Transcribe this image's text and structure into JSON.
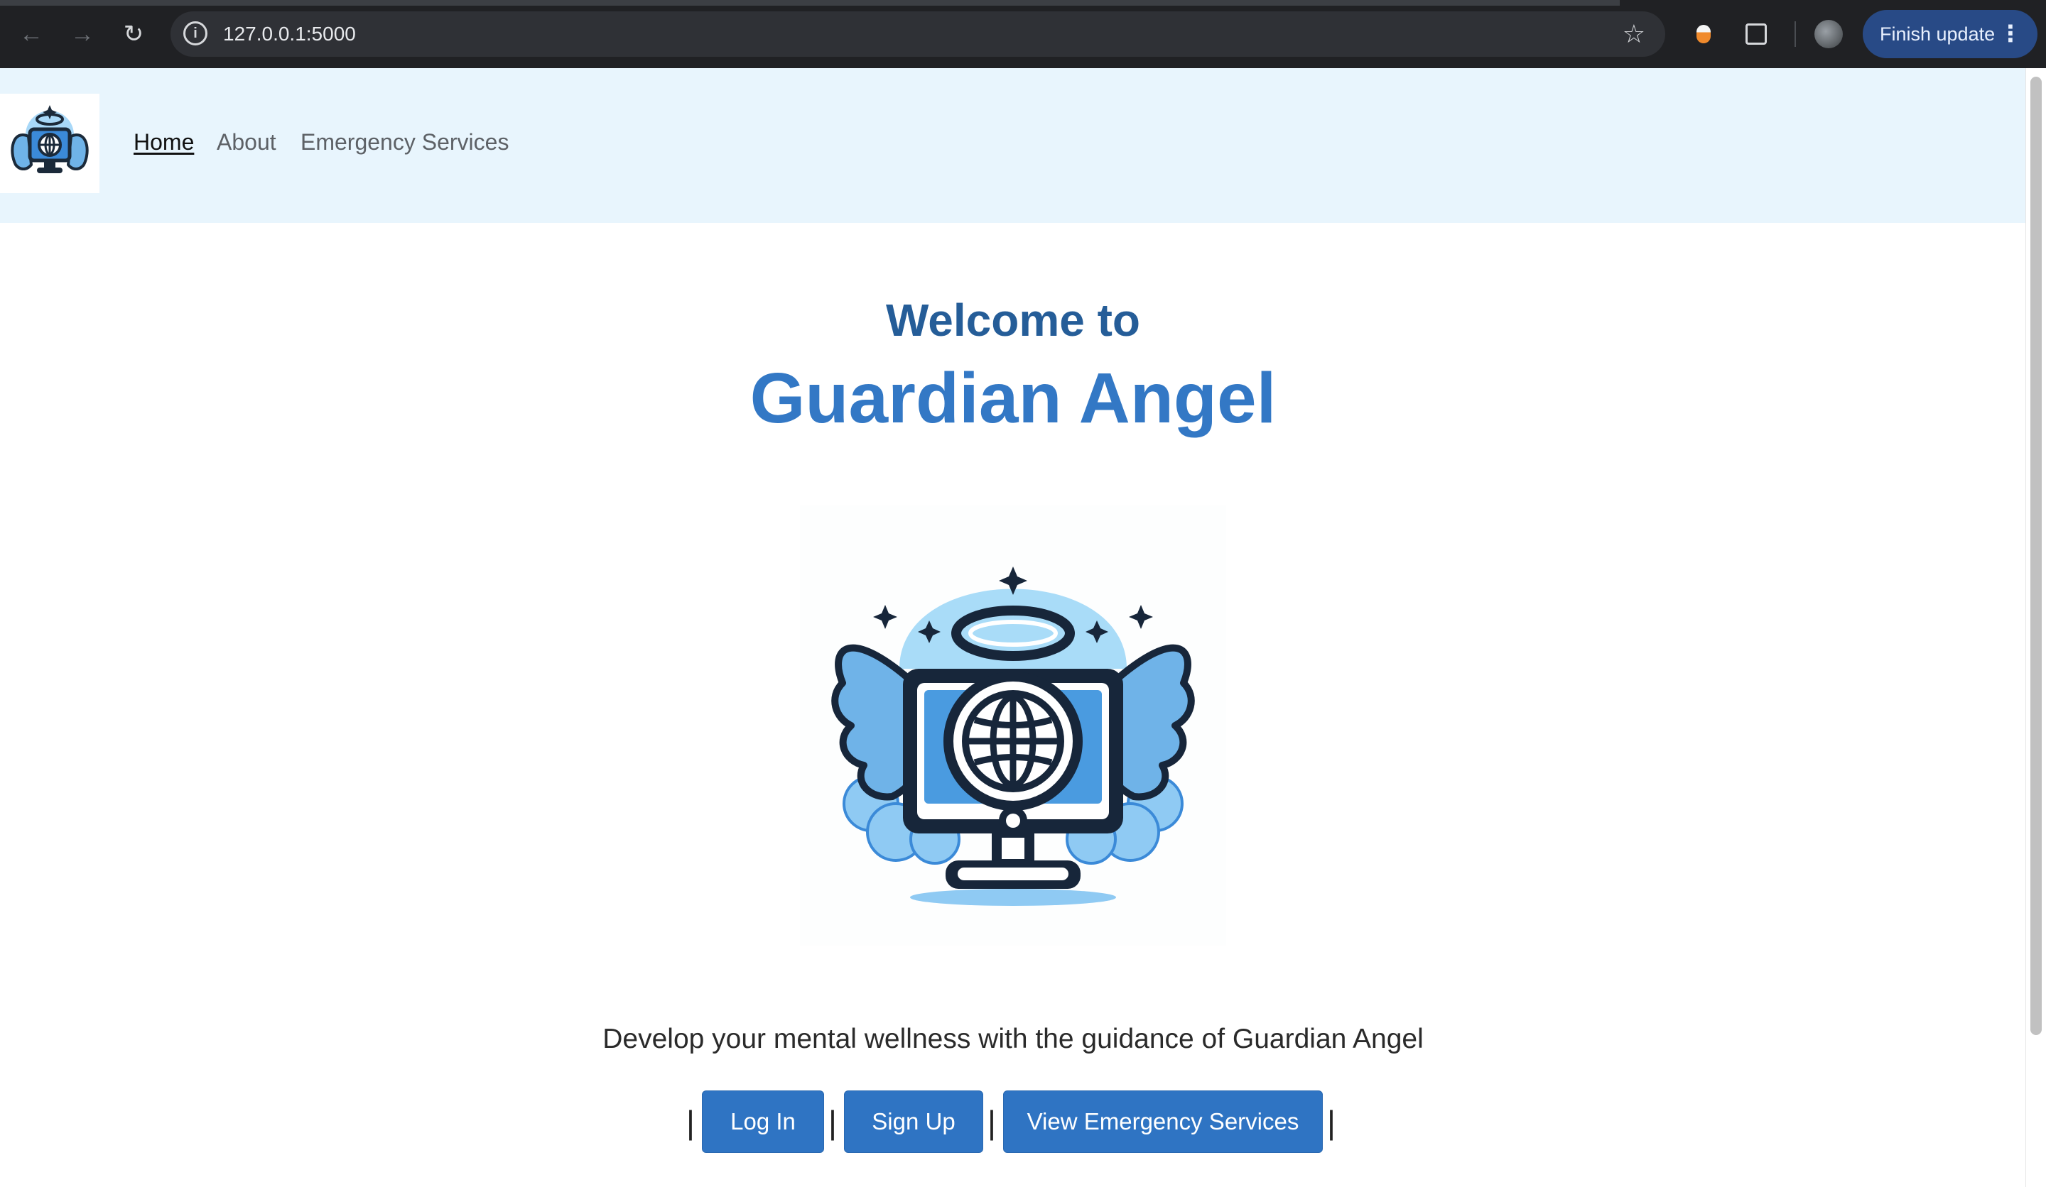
{
  "browser": {
    "url": "127.0.0.1:5000",
    "update_label": "Finish update",
    "icons": [
      "back-icon",
      "forward-icon",
      "reload-icon",
      "site-info-icon",
      "bookmark-star-icon",
      "extension-icon",
      "puzzle-icon",
      "profile-avatar",
      "menu-kebab-icon"
    ]
  },
  "navbar": {
    "links": [
      {
        "label": "Home",
        "current": true
      },
      {
        "label": "About"
      },
      {
        "label": "Emergency Services"
      }
    ]
  },
  "hero": {
    "welcome": "Welcome to",
    "title": "Guardian Angel",
    "tagline": "Develop your mental wellness with the guidance of Guardian Angel"
  },
  "actions": {
    "separator": "|",
    "login_label": "Log In",
    "signup_label": "Sign Up",
    "emergency_label": "View Emergency Services"
  },
  "colors": {
    "navbar_bg": "#e8f5fd",
    "heading": "#255d98",
    "title": "#3378c5",
    "button": "#2f74c3",
    "chrome_update": "#284a86"
  }
}
